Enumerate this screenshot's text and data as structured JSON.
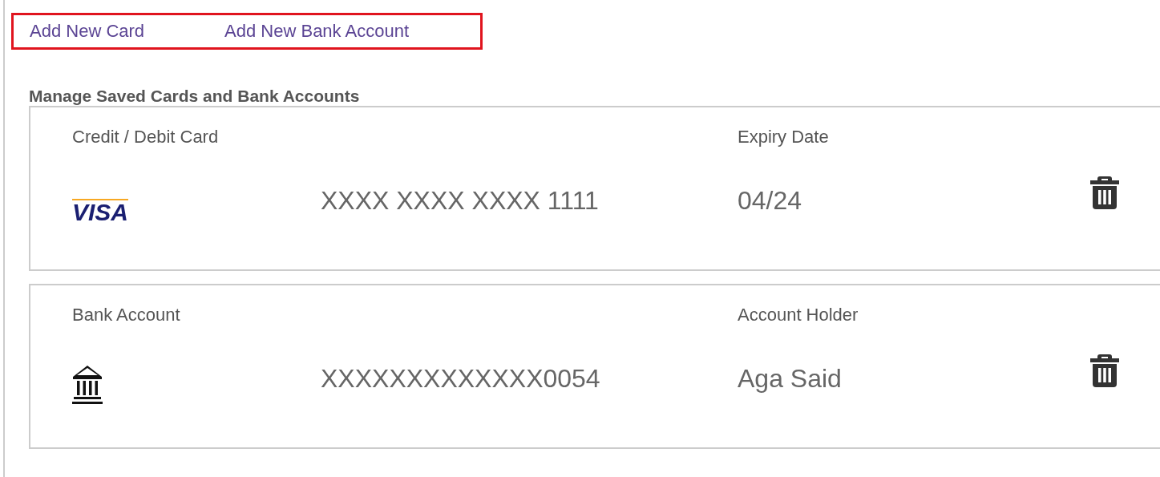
{
  "actions": [
    {
      "label": "Add New Card"
    },
    {
      "label": "Add New Bank Account"
    }
  ],
  "heading": "Manage Saved Cards and Bank Accounts",
  "accounts": [
    {
      "kind": "card",
      "type_label": "Credit / Debit Card",
      "logo_text": "VISA",
      "number": "XXXX XXXX XXXX 1111",
      "detail_label": "Expiry Date",
      "detail_value": "04/24"
    },
    {
      "kind": "bank",
      "type_label": "Bank Account",
      "number": "XXXXXXXXXXXXX0054",
      "detail_label": "Account Holder",
      "detail_value": "Aga Said"
    }
  ]
}
